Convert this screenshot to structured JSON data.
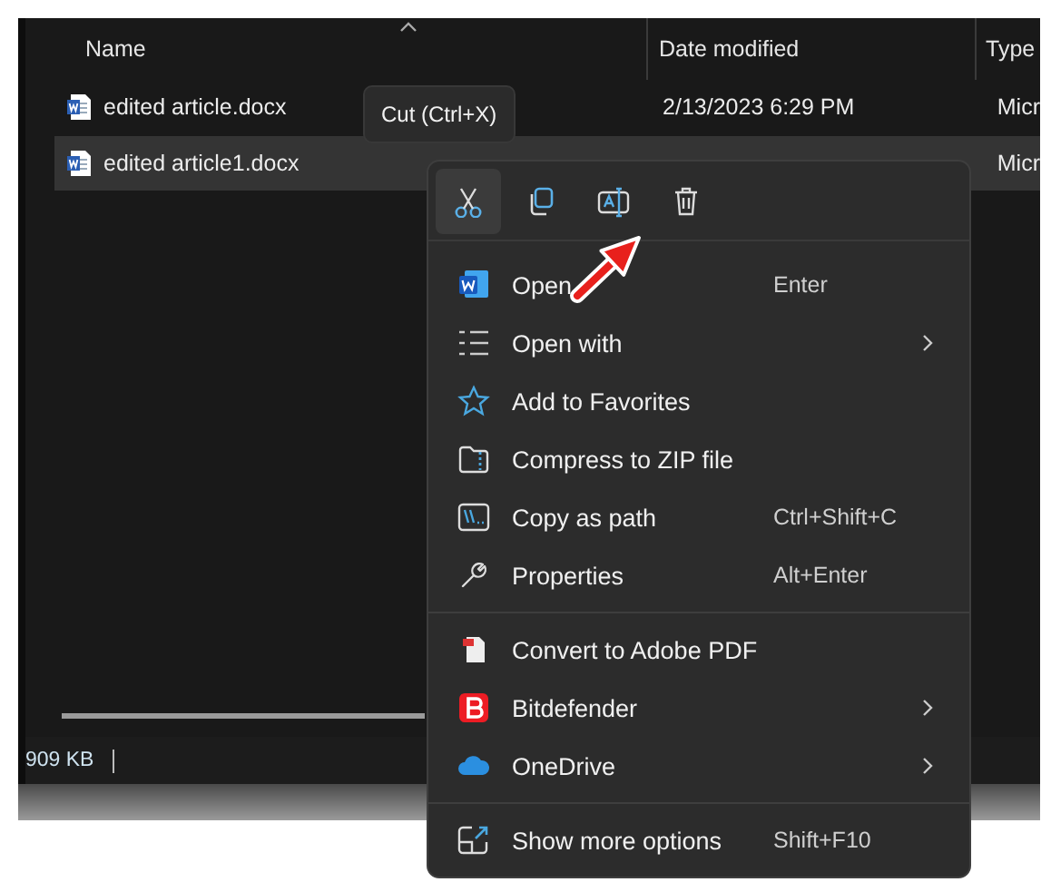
{
  "columns": [
    {
      "label": "Name",
      "sorted": true
    },
    {
      "label": "Date modified",
      "sorted": false
    },
    {
      "label": "Type",
      "sorted": false
    }
  ],
  "files": [
    {
      "name": "edited article.docx",
      "date": "2/13/2023 6:29 PM",
      "type": "Micr",
      "selected": false
    },
    {
      "name": "edited article1.docx",
      "type": "Micr",
      "selected": true
    }
  ],
  "status_bar": {
    "size": "909 KB"
  },
  "tooltip": "Cut (Ctrl+X)",
  "context_menu": {
    "toolbar": [
      {
        "kind": "cut",
        "selected": true
      },
      {
        "kind": "copy",
        "selected": false
      },
      {
        "kind": "rename",
        "selected": false
      },
      {
        "kind": "delete",
        "selected": false
      }
    ],
    "groups": [
      {
        "items": [
          {
            "kind": "word",
            "label": "Open",
            "shortcut": "Enter",
            "submenu": false
          },
          {
            "kind": "openwith",
            "label": "Open with",
            "submenu": true
          },
          {
            "kind": "star",
            "label": "Add to Favorites",
            "submenu": false
          },
          {
            "kind": "zip",
            "label": "Compress to ZIP file",
            "submenu": false
          },
          {
            "kind": "path",
            "label": "Copy as path",
            "shortcut": "Ctrl+Shift+C",
            "submenu": false
          },
          {
            "kind": "wrench",
            "label": "Properties",
            "shortcut": "Alt+Enter",
            "submenu": false
          }
        ]
      },
      {
        "items": [
          {
            "kind": "pdf",
            "label": "Convert to Adobe PDF",
            "submenu": false
          },
          {
            "kind": "bitdefender",
            "label": "Bitdefender",
            "submenu": true
          },
          {
            "kind": "cloud",
            "label": "OneDrive",
            "submenu": true
          }
        ]
      },
      {
        "items": [
          {
            "kind": "more",
            "label": "Show more options",
            "shortcut": "Shift+F10",
            "submenu": false
          }
        ]
      }
    ]
  }
}
